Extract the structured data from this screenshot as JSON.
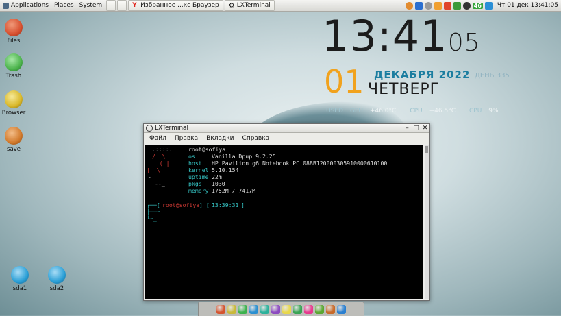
{
  "top_panel": {
    "menus": [
      "Applications",
      "Places",
      "System"
    ],
    "tasks": [
      {
        "label": "Избранное ...кс Браузер",
        "icon": "yandex-browser-icon"
      },
      {
        "label": "LXTerminal",
        "icon": "gear-icon"
      }
    ],
    "tray": {
      "temp_badge": "46",
      "datetime": "Чт 01 дек 13:41:05"
    }
  },
  "desktop_icons": [
    {
      "label": "Files",
      "icon": "home-folder-icon",
      "color": "#d7502f"
    },
    {
      "label": "Trash",
      "icon": "trash-icon",
      "color": "#4cb44c"
    },
    {
      "label": "Browser",
      "icon": "browser-globe-icon",
      "color": "#d9b82a"
    },
    {
      "label": "save",
      "icon": "save-download-icon",
      "color": "#d27a2c"
    },
    {
      "label": "sda1",
      "icon": "usb-drive-icon",
      "color": "#2a9fd6"
    },
    {
      "label": "sda2",
      "icon": "usb-drive-icon",
      "color": "#2a9fd6"
    }
  ],
  "conky": {
    "time_hm": "13:41",
    "time_sec": "05",
    "day": "01",
    "month_year": "ДЕКАБРЯ 2022",
    "day_of_year_label": "ДЕНЬ",
    "day_of_year": "335",
    "weekday": "ЧЕТВЕРГ",
    "sensors": [
      {
        "label": "USED",
        "value": ""
      },
      {
        "label": "GPU",
        "value": "+46.0°C"
      },
      {
        "label": "CPU",
        "value": "+46.5°C"
      },
      {
        "label": "CPU",
        "value": "9%"
      }
    ]
  },
  "terminal": {
    "title": "LXTerminal",
    "menu": [
      "Файл",
      "Правка",
      "Вкладки",
      "Справка"
    ],
    "fetch": {
      "user_host": "root@sofiya",
      "rows": [
        {
          "key": "os",
          "value": "Vanilla Dpup 9.2.25"
        },
        {
          "key": "host",
          "value": "HP Pavilion g6 Notebook PC 088B120000305910000610100"
        },
        {
          "key": "kernel",
          "value": "5.10.154"
        },
        {
          "key": "uptime",
          "value": "22m"
        },
        {
          "key": "pkgs",
          "value": "1030"
        },
        {
          "key": "memory",
          "value": "1752M / 7417M"
        }
      ],
      "logo": [
        ".::::.",
        "/  \\ ",
        "|  ( |",
        "|  \\__",
        "-_   ",
        "--_  "
      ]
    },
    "prompt": {
      "user_host": "root@sofiya",
      "time": "13:39:31"
    }
  },
  "dock_colors": [
    "#d5542f",
    "#c9b93a",
    "#3bb24d",
    "#2a8fd0",
    "#2bb19b",
    "#8c4bc0",
    "#e8d84a",
    "#39a455",
    "#e6398e",
    "#5aa832",
    "#c86a2a",
    "#2a7fd0"
  ]
}
